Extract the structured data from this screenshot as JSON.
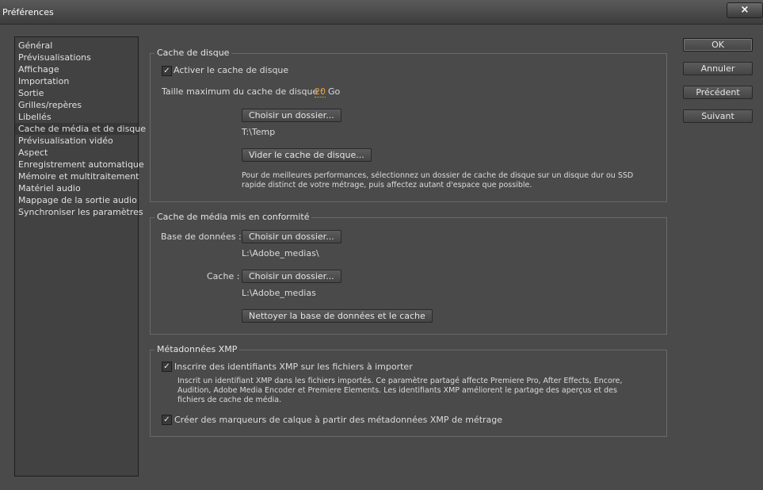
{
  "window": {
    "title": "Préférences",
    "close_symbol": "×"
  },
  "sidebar": {
    "items": [
      {
        "label": "Général"
      },
      {
        "label": "Prévisualisations"
      },
      {
        "label": "Affichage"
      },
      {
        "label": "Importation"
      },
      {
        "label": "Sortie"
      },
      {
        "label": "Grilles/repères"
      },
      {
        "label": "Libellés"
      },
      {
        "label": "Cache de média et de disque"
      },
      {
        "label": "Prévisualisation vidéo"
      },
      {
        "label": "Aspect"
      },
      {
        "label": "Enregistrement automatique"
      },
      {
        "label": "Mémoire et multitraitement"
      },
      {
        "label": "Matériel audio"
      },
      {
        "label": "Mappage de la sortie audio"
      },
      {
        "label": "Synchroniser les paramètres"
      }
    ],
    "selected_index": 7
  },
  "disk_cache": {
    "legend": "Cache de disque",
    "enable_label": "Activer le cache de disque",
    "enable_checked": true,
    "max_size_label": "Taille maximum du cache de disque :",
    "max_size_value": "20",
    "max_size_unit": "Go",
    "choose_folder_button": "Choisir un dossier...",
    "folder_path": "T:\\Temp",
    "clear_button": "Vider le cache de disque...",
    "note": "Pour de meilleures performances, sélectionnez un dossier de cache de disque sur un disque dur ou SSD rapide distinct de votre métrage, puis affectez autant d'espace que possible."
  },
  "media_cache": {
    "legend": "Cache de média mis en conformité",
    "database_label": "Base de données :",
    "database_button": "Choisir un dossier...",
    "database_path": "L:\\Adobe_medias\\",
    "cache_label": "Cache :",
    "cache_button": "Choisir un dossier...",
    "cache_path": "L:\\Adobe_medias",
    "clean_button": "Nettoyer la base de données et le cache"
  },
  "xmp": {
    "legend": "Métadonnées XMP",
    "write_ids_label": "Inscrire des identifiants XMP sur les fichiers à importer",
    "write_ids_checked": true,
    "write_ids_note": "Inscrit un identifiant XMP dans les fichiers importés. Ce paramètre partagé affecte Premiere Pro, After Effects, Encore, Audition, Adobe Media Encoder et Premiere Elements. Les identifiants XMP améliorent le partage des aperçus et des fichiers de cache de média.",
    "markers_label": "Créer des marqueurs de calque à partir des métadonnées XMP de métrage",
    "markers_checked": true
  },
  "right_buttons": {
    "ok": "OK",
    "cancel": "Annuler",
    "previous": "Précédent",
    "next": "Suivant"
  },
  "check_symbol": "✓"
}
